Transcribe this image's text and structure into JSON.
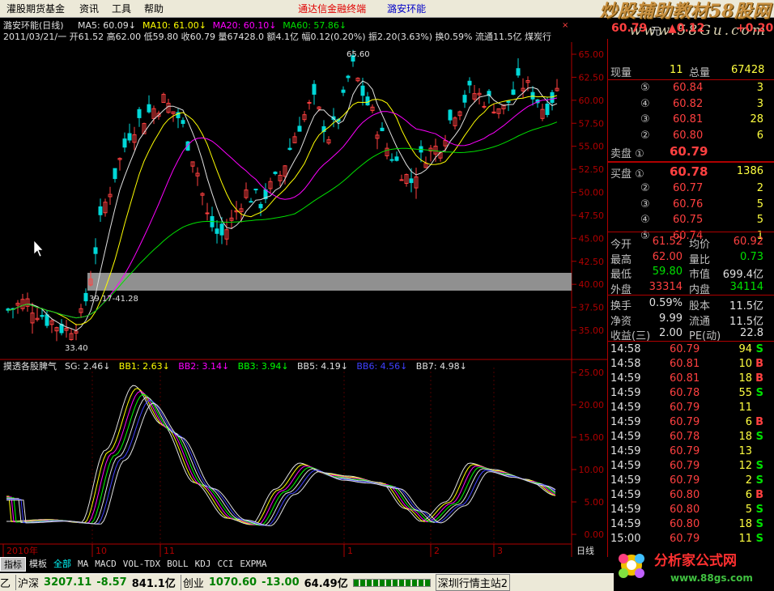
{
  "menu": {
    "app_title": "灌股期货基金",
    "items": [
      "资讯",
      "工具",
      "帮助"
    ],
    "promo": "通达信金融终端",
    "stock_tab": "潞安环能"
  },
  "brand": {
    "line1": "炒股辅助教材58股网",
    "line2": "www.58Gu.com"
  },
  "header": {
    "stock": "潞安环能(日线)",
    "ma": [
      {
        "label": "MA5: 60.09",
        "color": "#e0e0e0"
      },
      {
        "label": "MA10: 61.00",
        "color": "#ffff00"
      },
      {
        "label": "MA20: 60.10",
        "color": "#ff00ff"
      },
      {
        "label": "MA60: 57.86",
        "color": "#00e000"
      }
    ],
    "info": "2011/03/21/一 开61.52 高62.00 低59.80 收60.79 量67428.0 额4.1亿 幅0.12(0.20%) 振2.20(3.63%) 换0.59% 流通11.5亿 煤炭行",
    "close_box": "×"
  },
  "annotations": {
    "high": "65.60",
    "low": "33.40",
    "gap": "39.17-41.28"
  },
  "indicator": {
    "name": "摸透各股脾气",
    "items": [
      {
        "label": "SG: 2.46",
        "color": "#e0e0e0"
      },
      {
        "label": "BB1: 2.63",
        "color": "#ffff00"
      },
      {
        "label": "BB2: 3.14",
        "color": "#ff00ff"
      },
      {
        "label": "BB3: 3.94",
        "color": "#00ff00"
      },
      {
        "label": "BB5: 4.19",
        "color": "#e0e0e0"
      },
      {
        "label": "BB6: 4.56",
        "color": "#4040ff"
      },
      {
        "label": "BB7: 4.98",
        "color": "#e0e0e0"
      }
    ]
  },
  "price_axis": [
    "65.00",
    "62.50",
    "60.00",
    "57.50",
    "55.00",
    "52.50",
    "50.00",
    "47.50",
    "45.00",
    "42.50",
    "40.00",
    "37.50",
    "35.00"
  ],
  "ind_axis": [
    "25.00",
    "20.00",
    "15.00",
    "10.00",
    "5.00",
    "0.00"
  ],
  "time_axis": [
    "2010年",
    "10",
    "11",
    "1",
    "2",
    "3"
  ],
  "period": "日线",
  "quote": {
    "price": "60.79",
    "unit": "元",
    "change": "▲0.12",
    "change2": "+0.20",
    "volume_label": "现量",
    "volume": "11",
    "total_label": "总量",
    "total": "67428",
    "asks": [
      {
        "lvl": "⑤",
        "price": "60.84",
        "vol": "3"
      },
      {
        "lvl": "④",
        "price": "60.82",
        "vol": "3"
      },
      {
        "lvl": "③",
        "price": "60.81",
        "vol": "28"
      },
      {
        "lvl": "②",
        "price": "60.80",
        "vol": "6"
      }
    ],
    "ask1_label": "卖盘 ①",
    "ask1_price": "60.79",
    "bid1_label": "买盘 ①",
    "bid1_price": "60.78",
    "bid1_vol": "1386",
    "bids": [
      {
        "lvl": "②",
        "price": "60.77",
        "vol": "2"
      },
      {
        "lvl": "③",
        "price": "60.76",
        "vol": "5"
      },
      {
        "lvl": "④",
        "price": "60.75",
        "vol": "5"
      },
      {
        "lvl": "⑤",
        "price": "60.74",
        "vol": "1"
      }
    ],
    "stats": [
      {
        "l1": "今开",
        "v1": "61.52",
        "c1": "red",
        "l2": "均价",
        "v2": "60.92",
        "c2": "red"
      },
      {
        "l1": "最高",
        "v1": "62.00",
        "c1": "red",
        "l2": "量比",
        "v2": "0.73",
        "c2": "grn"
      },
      {
        "l1": "最低",
        "v1": "59.80",
        "c1": "grn",
        "l2": "市值",
        "v2": "699.4亿",
        "c2": "wht"
      },
      {
        "l1": "外盘",
        "v1": "33314",
        "c1": "red",
        "l2": "内盘",
        "v2": "34114",
        "c2": "grn"
      }
    ],
    "fund": [
      {
        "l1": "换手",
        "v1": "0.59%",
        "l2": "股本",
        "v2": "11.5亿"
      },
      {
        "l1": "净资",
        "v1": "9.99",
        "l2": "流通",
        "v2": "11.5亿"
      },
      {
        "l1": "收益(三)",
        "v1": "2.00",
        "l2": "PE(动)",
        "v2": "22.8"
      }
    ],
    "ticks": [
      {
        "t": "14:58",
        "p": "60.79",
        "v": "94",
        "s": "S"
      },
      {
        "t": "14:58",
        "p": "60.81",
        "v": "10",
        "s": "B"
      },
      {
        "t": "14:59",
        "p": "60.81",
        "v": "18",
        "s": "B"
      },
      {
        "t": "14:59",
        "p": "60.78",
        "v": "55",
        "s": "S"
      },
      {
        "t": "14:59",
        "p": "60.79",
        "v": "11",
        "s": ""
      },
      {
        "t": "14:59",
        "p": "60.79",
        "v": "6",
        "s": "B"
      },
      {
        "t": "14:59",
        "p": "60.78",
        "v": "18",
        "s": "S"
      },
      {
        "t": "14:59",
        "p": "60.79",
        "v": "13",
        "s": ""
      },
      {
        "t": "14:59",
        "p": "60.79",
        "v": "12",
        "s": "S"
      },
      {
        "t": "14:59",
        "p": "60.79",
        "v": "2",
        "s": "S"
      },
      {
        "t": "14:59",
        "p": "60.80",
        "v": "6",
        "s": "B"
      },
      {
        "t": "14:59",
        "p": "60.80",
        "v": "5",
        "s": "S"
      },
      {
        "t": "14:59",
        "p": "60.80",
        "v": "18",
        "s": "S"
      },
      {
        "t": "15:00",
        "p": "60.79",
        "v": "11",
        "s": "S"
      }
    ]
  },
  "tabs": [
    "指标",
    "模板",
    "全部",
    "MA",
    "MACD",
    "VOL-TDX",
    "BOLL",
    "KDJ",
    "CCI",
    "EXPMA"
  ],
  "status": {
    "lead": "乙",
    "idx1_name": "沪深",
    "idx1_val": "3207.11",
    "idx1_chg": "-8.57",
    "idx1_amt": "841.1亿",
    "idx2_name": "创业",
    "idx2_val": "1070.60",
    "idx2_chg": "-13.00",
    "idx2_amt": "64.49亿",
    "server": "深圳行情主站2"
  },
  "logo": {
    "text": "分析家公式网",
    "url": "www.88gs.com"
  },
  "colors": {
    "up": "#ff4040",
    "down": "#00d8d8",
    "bg": "#000000",
    "frame": "#b00000"
  }
}
